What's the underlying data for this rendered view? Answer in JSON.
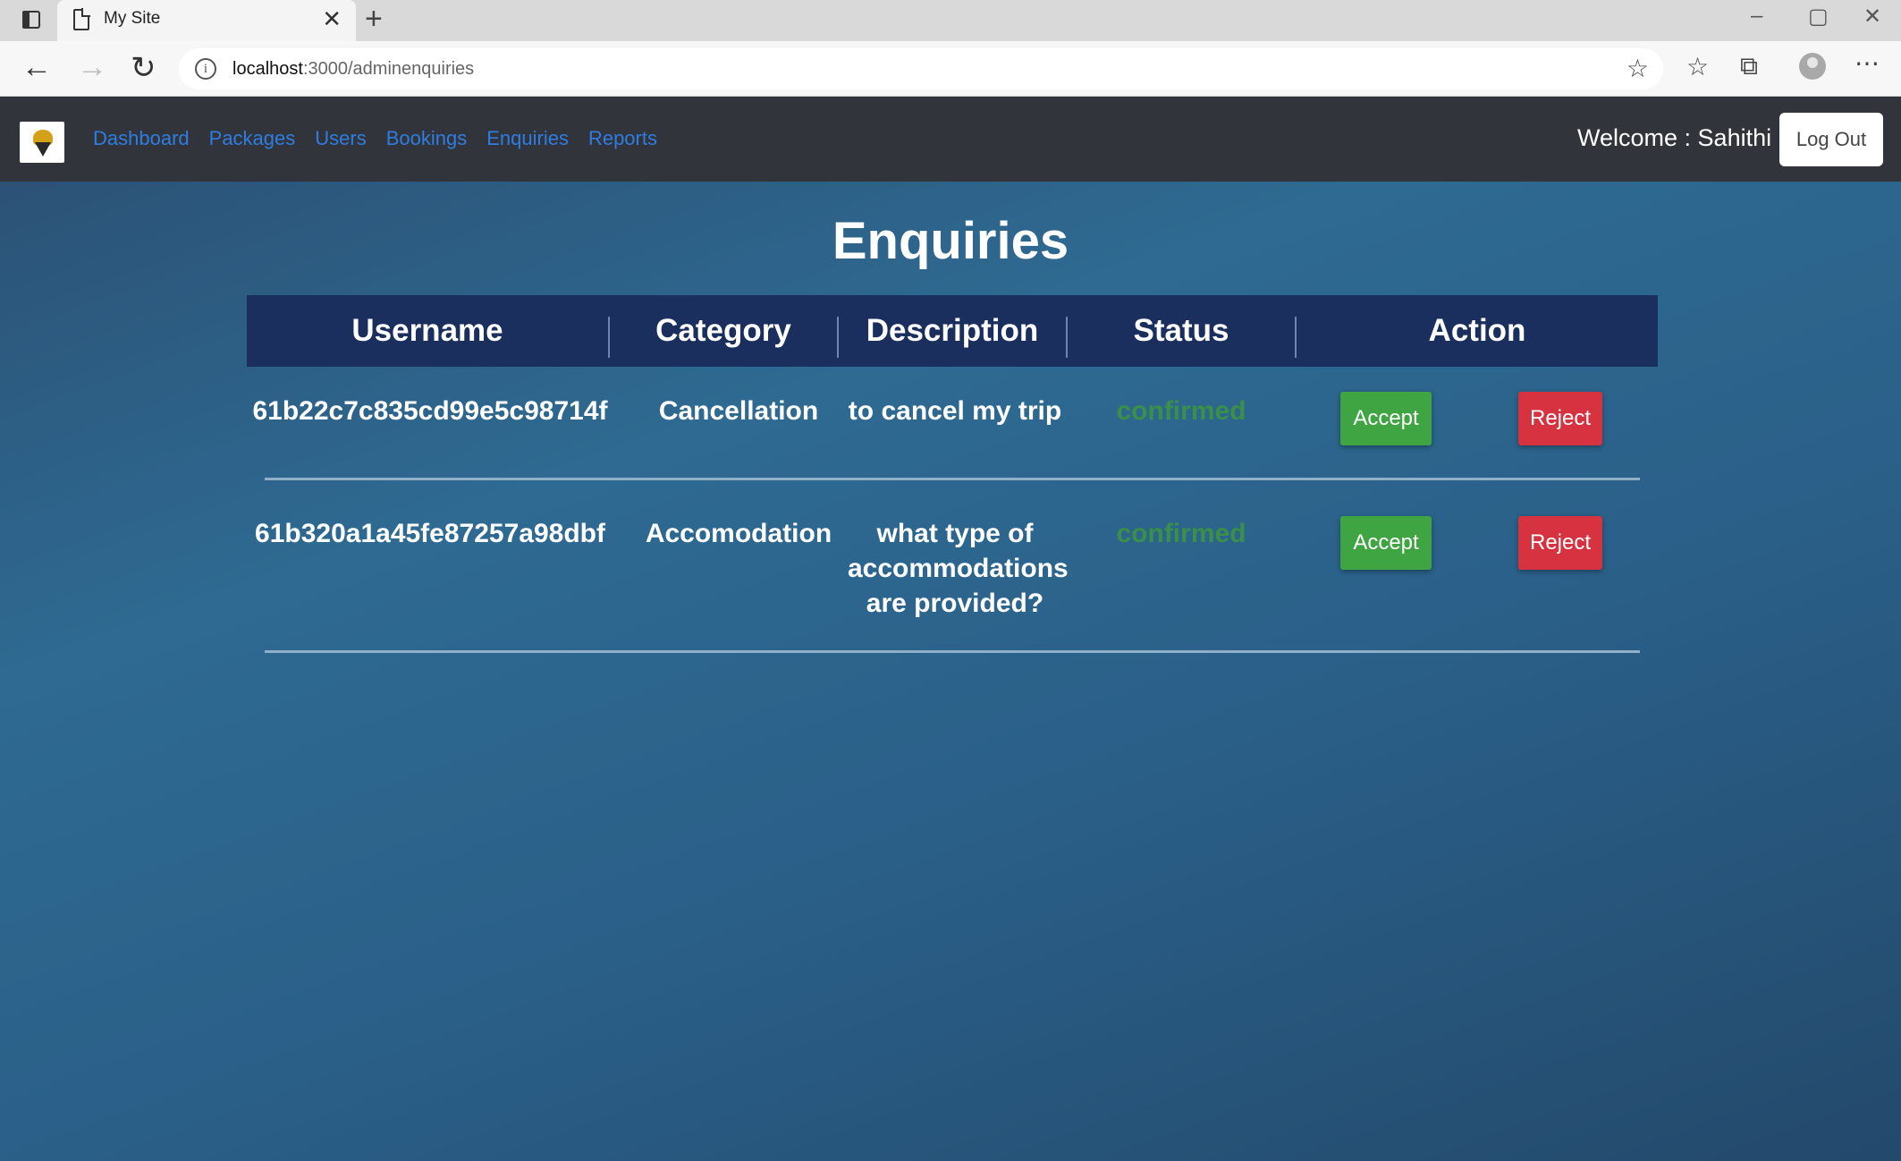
{
  "browser": {
    "tab_title": "My Site",
    "tab_close": "✕",
    "new_tab": "+",
    "url_host": "localhost",
    "url_rest": ":3000/adminenquiries",
    "controls": {
      "minimize": "–",
      "restore": "▢",
      "close": "✕"
    },
    "nav": {
      "back": "←",
      "forward": "→",
      "refresh": "↻"
    },
    "toolbar_icons": [
      "star-add-icon",
      "favorites-icon",
      "collections-icon",
      "profile-icon",
      "more-icon"
    ]
  },
  "navbar": {
    "links": [
      "Dashboard",
      "Packages",
      "Users",
      "Bookings",
      "Enquiries",
      "Reports"
    ],
    "welcome": "Welcome : Sahithi |",
    "logout": "Log Out"
  },
  "page": {
    "title": "Enquiries",
    "columns": [
      "Username",
      "Category",
      "Description",
      "Status",
      "Action"
    ],
    "rows": [
      {
        "username": "61b22c7c835cd99e5c98714f",
        "category": "Cancellation",
        "description": "to cancel my trip",
        "status": "confirmed",
        "accept": "Accept",
        "reject": "Reject"
      },
      {
        "username": "61b320a1a45fe87257a98dbf",
        "category": "Accomodation",
        "description": "what type of accommodations are provided?",
        "status": "confirmed",
        "accept": "Accept",
        "reject": "Reject"
      }
    ]
  },
  "colors": {
    "navbar": "#31343b",
    "link": "#2f7de0",
    "table_header": "#1a2f5e",
    "status_confirmed": "#3a8f4a",
    "accept": "#3fa442",
    "reject": "#d6323f"
  }
}
